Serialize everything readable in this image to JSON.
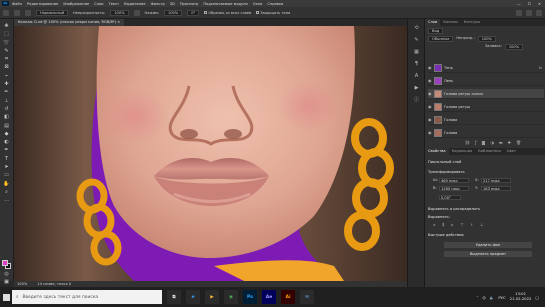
{
  "app": {
    "logo": "Ps",
    "menu": [
      "Файл",
      "Редактирование",
      "Изображение",
      "Слои",
      "Текст",
      "Выделение",
      "Фильтр",
      "3D",
      "Просмотр",
      "Подключаемые модули",
      "Окно",
      "Справка"
    ],
    "window_controls": [
      "—",
      "☐",
      "✕"
    ]
  },
  "options_bar": {
    "mode_label": "Нормальный",
    "opacity_label": "Непрозрачность:",
    "opacity_value": "100%",
    "flow_label": "Нажим:",
    "flow_value": "100%",
    "angle_value": "0°",
    "sample_all_label": "Образец со всех слоев",
    "protect_label": "Защищать тона"
  },
  "document": {
    "tab_title": "Коллаж Curd @ 100% (список рекрм копия, RGB/8*) ×"
  },
  "status_bar": {
    "zoom": "100%",
    "info": "14 сниме, точка 0"
  },
  "layers_panel": {
    "tabs": [
      "Слои",
      "Каналы",
      "Контуры"
    ],
    "kind_label": "Вид",
    "blend_mode": "Обычные",
    "opacity_label": "Непрозр.:",
    "opacity_value": "100%",
    "fill_label": "Заливка:",
    "fill_value": "100%",
    "layers": [
      {
        "name": "Тень",
        "fx": "fx",
        "thumb_color": "#7a2fb0",
        "selected": false
      },
      {
        "name": "Лень",
        "fx": "",
        "thumb_color": "#9a3fc0",
        "selected": false
      },
      {
        "name": "Голова ретуш копия",
        "fx": "",
        "thumb_color": "#c58a78",
        "selected": true
      },
      {
        "name": "Голова ретуш",
        "fx": "",
        "thumb_color": "#b97d6c",
        "selected": false
      },
      {
        "name": "Голова",
        "fx": "",
        "thumb_color": "#8a5a4c",
        "selected": false
      },
      {
        "name": "Голова",
        "fx": "",
        "thumb_color": "#a56d5e",
        "selected": false
      }
    ]
  },
  "properties_panel": {
    "tabs": [
      "Свойства",
      "Коррекция",
      "Библиотеки",
      "Цвет"
    ],
    "layer_type": "Пиксельный слой",
    "transform_head": "Трансформировать",
    "w_label": "Ш:",
    "w_value": "465 пикс",
    "x_label": "X:",
    "x_value": "217 пикс",
    "h_label": "В:",
    "h_value": "1260 пикс",
    "y_label": "Y:",
    "y_value": "163 пикс",
    "angle_value": "0,00°",
    "align_head": "Выровнять и распределить",
    "align_sub": "Выровнять:",
    "quick_head": "Быстрые действия",
    "btn_remove_bg": "Удалить фон",
    "btn_select_subject": "Выделить предмет"
  },
  "taskbar": {
    "search_placeholder": "Введите здесь текст для поиска",
    "apps": [
      {
        "label": "⧉",
        "color": "#2b2b2b",
        "text_color": "#ddd"
      },
      {
        "label": "e",
        "color": "#2b2b2b",
        "text_color": "#3aa0ff"
      },
      {
        "label": "▶",
        "color": "#2b2b2b",
        "text_color": "#ffbb33"
      },
      {
        "label": "◉",
        "color": "#2b2b2b",
        "text_color": "#4caf50"
      },
      {
        "label": "Ps",
        "color": "#001e36",
        "text_color": "#31a8ff"
      },
      {
        "label": "Ae",
        "color": "#00005b",
        "text_color": "#9999ff"
      },
      {
        "label": "Ai",
        "color": "#330000",
        "text_color": "#ff9a00"
      },
      {
        "label": "✉",
        "color": "#2b2b2b",
        "text_color": "#6ab0ff"
      }
    ],
    "lang": "РУС",
    "time": "13:01",
    "date": "21.02.2022"
  },
  "colors": {
    "accent": "#31a8ff",
    "foreground_swatch": "#e040c8",
    "background_swatch": "#111111",
    "canvas_bg": "#7d1bb4"
  }
}
